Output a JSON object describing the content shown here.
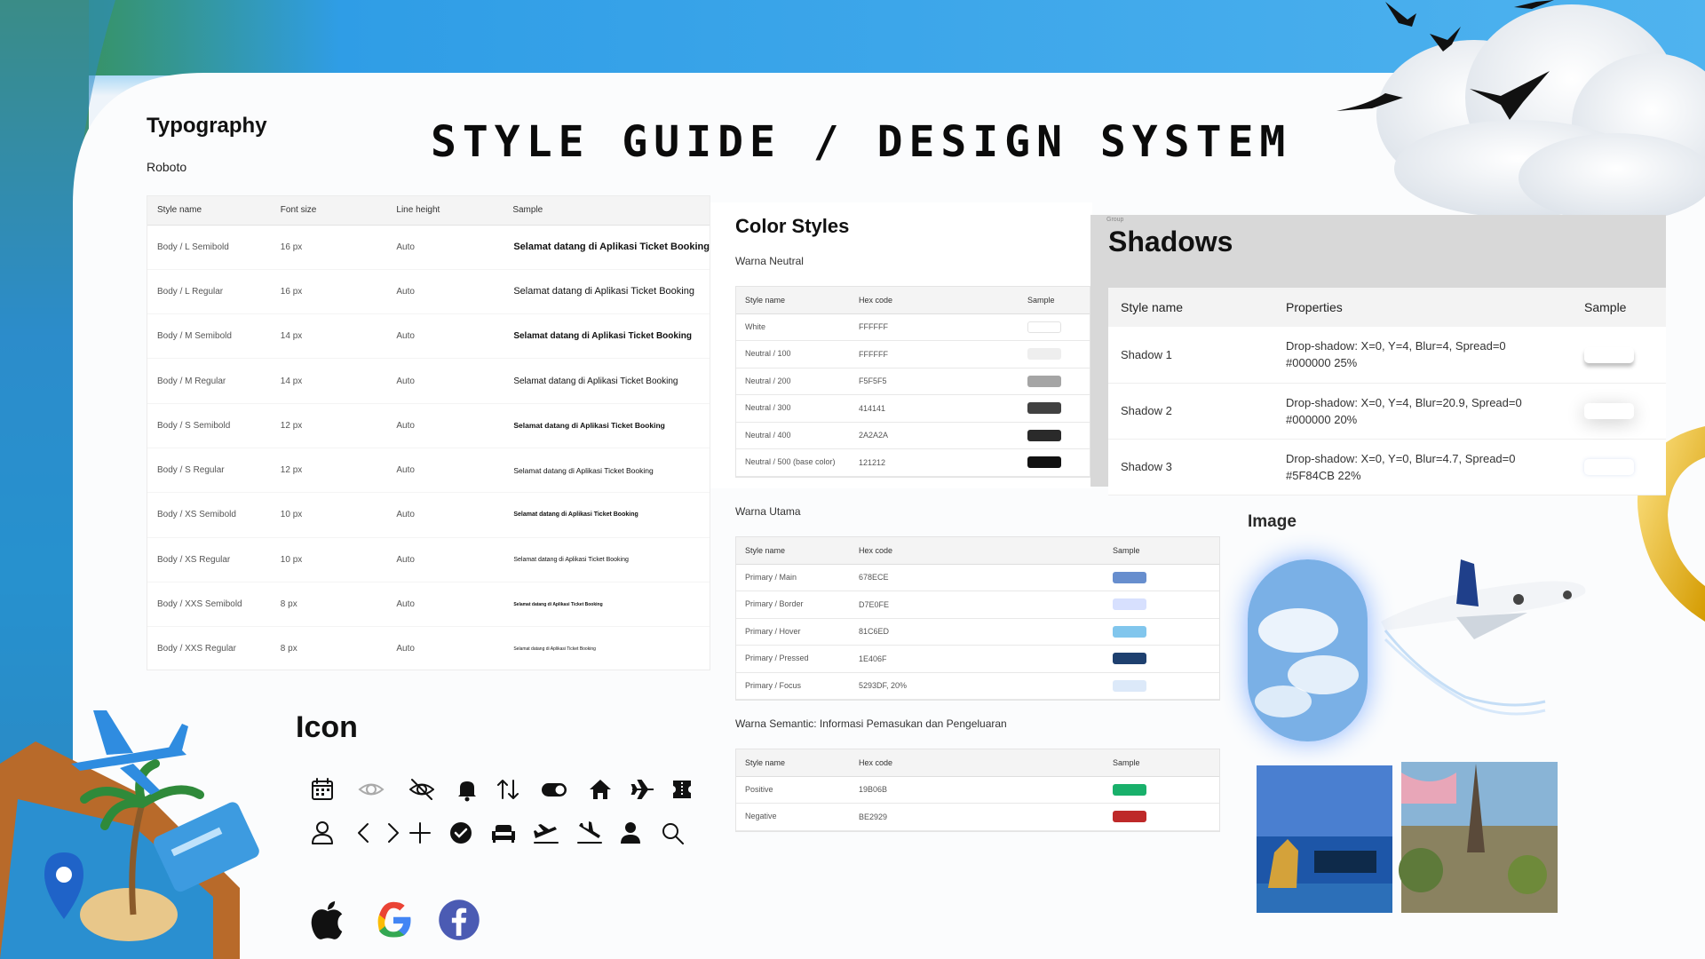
{
  "page": {
    "title": "STYLE GUIDE / DESIGN SYSTEM"
  },
  "typography": {
    "title": "Typography",
    "font_name": "Roboto",
    "headers": [
      "Style name",
      "Font size",
      "Line height",
      "Sample"
    ],
    "rows": [
      {
        "name": "Body / L Semibold",
        "size": "16 px",
        "line": "Auto",
        "sample": "Selamat datang di Aplikasi Ticket Booking",
        "weight": "bold",
        "sample_size": 11
      },
      {
        "name": "Body / L Regular",
        "size": "16 px",
        "line": "Auto",
        "sample": "Selamat datang di Aplikasi Ticket Booking",
        "weight": "normal",
        "sample_size": 11
      },
      {
        "name": "Body / M Semibold",
        "size": "14 px",
        "line": "Auto",
        "sample": "Selamat datang di Aplikasi Ticket Booking",
        "weight": "bold",
        "sample_size": 10
      },
      {
        "name": "Body / M Regular",
        "size": "14 px",
        "line": "Auto",
        "sample": "Selamat datang di Aplikasi Ticket Booking",
        "weight": "normal",
        "sample_size": 10
      },
      {
        "name": "Body / S Semibold",
        "size": "12 px",
        "line": "Auto",
        "sample": "Selamat datang di Aplikasi Ticket Booking",
        "weight": "bold",
        "sample_size": 8.5
      },
      {
        "name": "Body / S Regular",
        "size": "12 px",
        "line": "Auto",
        "sample": "Selamat datang di Aplikasi Ticket Booking",
        "weight": "normal",
        "sample_size": 8.5
      },
      {
        "name": "Body / XS Semibold",
        "size": "10 px",
        "line": "Auto",
        "sample": "Selamat datang di Aplikasi Ticket Booking",
        "weight": "bold",
        "sample_size": 7
      },
      {
        "name": "Body / XS Regular",
        "size": "10 px",
        "line": "Auto",
        "sample": "Selamat datang di Aplikasi Ticket Booking",
        "weight": "normal",
        "sample_size": 7
      },
      {
        "name": "Body / XXS Semibold",
        "size": "8 px",
        "line": "Auto",
        "sample": "Selamat datang di Aplikasi Ticket Booking",
        "weight": "bold",
        "sample_size": 5
      },
      {
        "name": "Body / XXS Regular",
        "size": "8 px",
        "line": "Auto",
        "sample": "Selamat datang di Aplikasi Ticket Booking",
        "weight": "normal",
        "sample_size": 5
      }
    ]
  },
  "colors": {
    "title": "Color Styles",
    "neutral": {
      "title": "Warna Neutral",
      "headers": [
        "Style name",
        "Hex code",
        "Sample"
      ],
      "rows": [
        {
          "name": "White",
          "hex": "FFFFFF",
          "color": "#FFFFFF"
        },
        {
          "name": "Neutral / 100",
          "hex": "FFFFFF",
          "color": "#EEEEEE"
        },
        {
          "name": "Neutral / 200",
          "hex": "F5F5F5",
          "color": "#A5A5A5"
        },
        {
          "name": "Neutral / 300",
          "hex": "414141",
          "color": "#414141"
        },
        {
          "name": "Neutral / 400",
          "hex": "2A2A2A",
          "color": "#2A2A2A"
        },
        {
          "name": "Neutral / 500 (base color)",
          "hex": "121212",
          "color": "#121212"
        }
      ]
    },
    "primary": {
      "title": "Warna Utama",
      "headers": [
        "Style name",
        "Hex code",
        "Sample"
      ],
      "rows": [
        {
          "name": "Primary / Main",
          "hex": "678ECE",
          "color": "#678ECE"
        },
        {
          "name": "Primary / Border",
          "hex": "D7E0FE",
          "color": "#D7E0FE"
        },
        {
          "name": "Primary / Hover",
          "hex": "81C6ED",
          "color": "#81C6ED"
        },
        {
          "name": "Primary / Pressed",
          "hex": "1E406F",
          "color": "#1E406F"
        },
        {
          "name": "Primary / Focus",
          "hex": "5293DF, 20%",
          "color": "#DCE9F9"
        }
      ]
    },
    "semantic": {
      "title": "Warna Semantic: Informasi Pemasukan dan Pengeluaran",
      "headers": [
        "Style name",
        "Hex code",
        "Sample"
      ],
      "rows": [
        {
          "name": "Positive",
          "hex": "19B06B",
          "color": "#19B06B"
        },
        {
          "name": "Negative",
          "hex": "BE2929",
          "color": "#BE2929"
        }
      ]
    }
  },
  "shadows": {
    "group_label": "Group",
    "title": "Shadows",
    "headers": [
      "Style name",
      "Properties",
      "Sample"
    ],
    "rows": [
      {
        "name": "Shadow 1",
        "prop1": "Drop-shadow: X=0, Y=4, Blur=4, Spread=0",
        "prop2": "#000000  25%"
      },
      {
        "name": "Shadow 2",
        "prop1": "Drop-shadow: X=0, Y=4, Blur=20.9, Spread=0",
        "prop2": "#000000  20%"
      },
      {
        "name": "Shadow 3",
        "prop1": "Drop-shadow: X=0, Y=0, Blur=4.7, Spread=0",
        "prop2": "#5F84CB  22%"
      }
    ]
  },
  "icons": {
    "title": "Icon",
    "row1": [
      "calendar-icon",
      "eye-icon",
      "eye-off-icon",
      "bell-icon",
      "sort-arrows-icon",
      "toggle-icon",
      "home-icon",
      "airplane-icon",
      "ticket-icon"
    ],
    "row2": [
      "user-icon",
      "chevron-left-icon",
      "chevron-right-icon",
      "plus-icon",
      "check-circle-icon",
      "sofa-icon",
      "plane-takeoff-icon",
      "plane-landing-icon",
      "person-icon",
      "search-icon"
    ],
    "brands": [
      "apple-logo",
      "google-logo",
      "facebook-logo"
    ]
  },
  "image_section": {
    "title": "Image"
  }
}
